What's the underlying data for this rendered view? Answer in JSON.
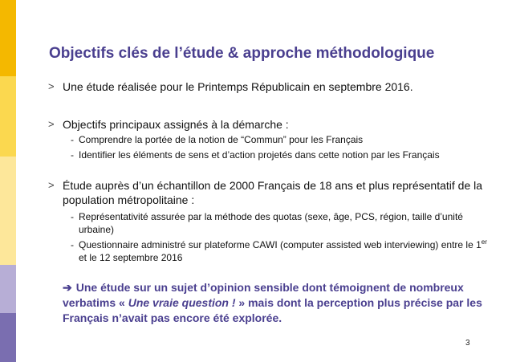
{
  "title": "Objectifs clés de l’étude & approche méthodologique",
  "bullet_marker": ">",
  "sub_marker": "-",
  "bullets": [
    {
      "text": "Une étude réalisée pour le Printemps Républicain en septembre 2016."
    },
    {
      "text": "Objectifs principaux assignés à la démarche :",
      "subs": [
        "Comprendre la portée de la notion de “Commun” pour les Français",
        "Identifier les éléments de sens et d’action projetés dans cette notion par les Français"
      ]
    },
    {
      "text": "Étude auprès d’un échantillon de 2000 Français de 18 ans et plus représentatif de la population métropolitaine :",
      "subs": [
        "Représentativité assurée par la méthode des quotas (sexe, âge, PCS, région, taille d’unité urbaine)",
        {
          "before": "Questionnaire administré sur plateforme CAWI (computer assisted web interviewing) entre le 1",
          "sup": "er",
          "after": " et le 12 septembre 2016"
        }
      ]
    }
  ],
  "conclusion": {
    "arrow": "➔",
    "part1": "Une étude sur un sujet d’opinion sensible dont témoignent de nombreux verbatims « ",
    "quote": "Une vraie question !",
    "part2": " » mais dont la perception plus précise par les Français n’avait pas encore été explorée."
  },
  "page_number": "3",
  "colors": {
    "title": "#4a3f8f",
    "sidebar": [
      "#f4b800",
      "#fbd84f",
      "#fde79a",
      "#b7aed6",
      "#7a6eb0"
    ]
  }
}
